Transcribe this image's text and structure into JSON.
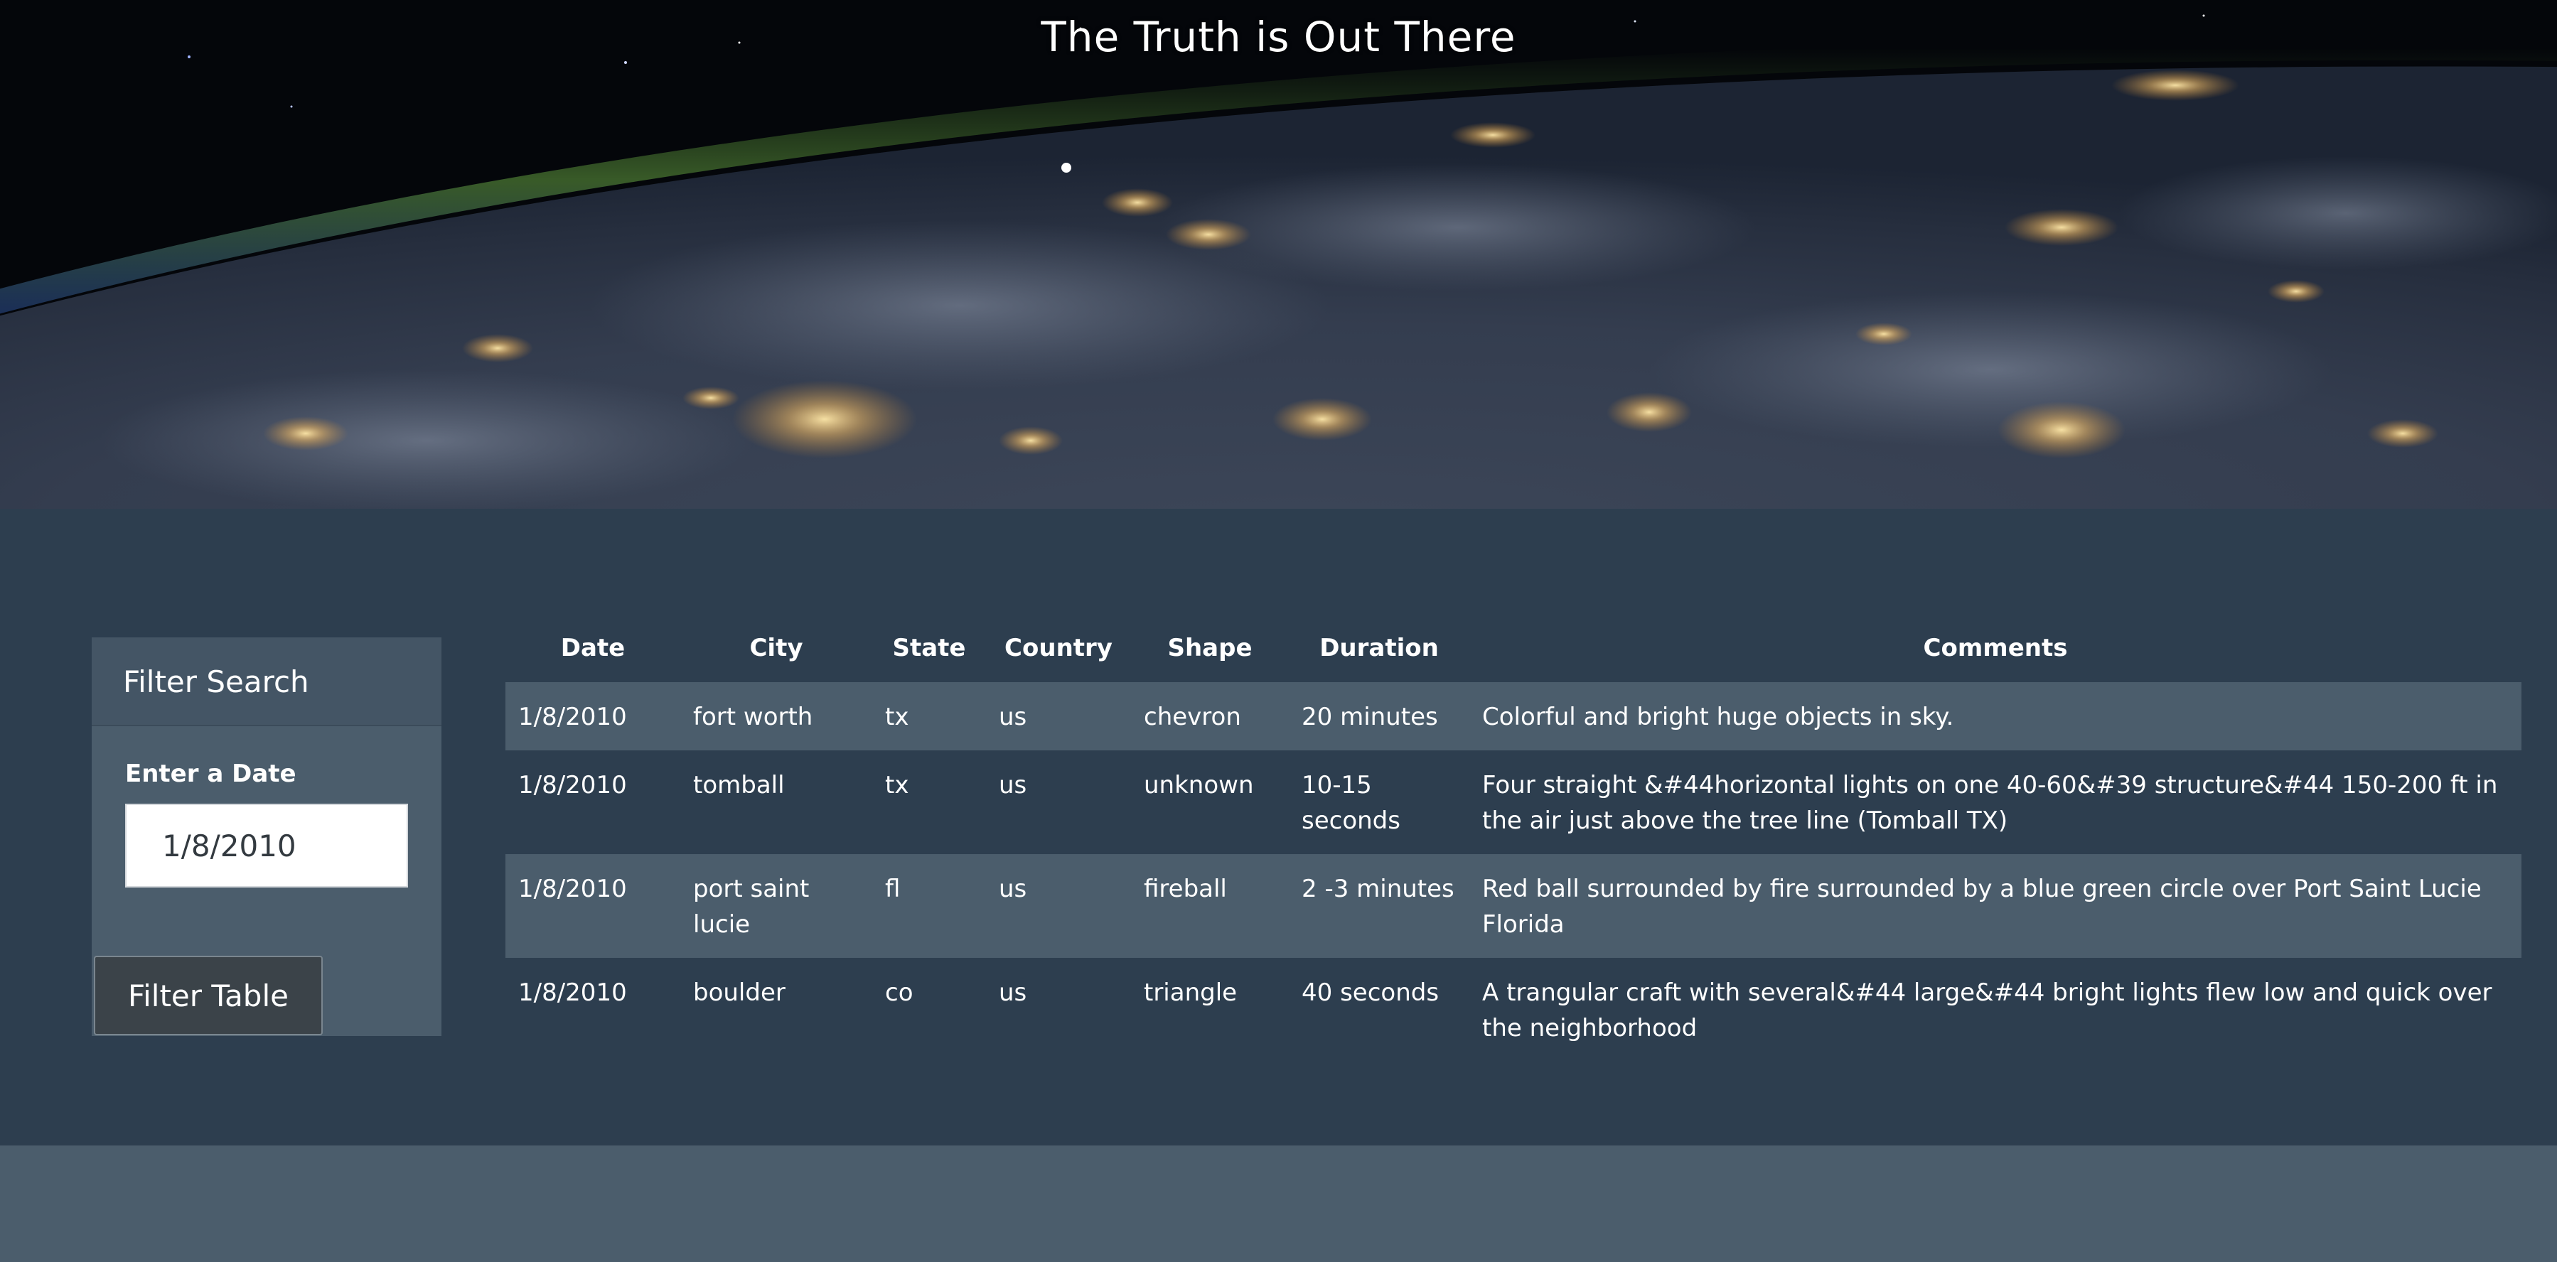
{
  "header": {
    "title": "The Truth is Out There"
  },
  "filter": {
    "heading": "Filter Search",
    "date_label": "Enter a Date",
    "date_value": "1/8/2010",
    "button_label": "Filter Table"
  },
  "table": {
    "headers": {
      "date": "Date",
      "city": "City",
      "state": "State",
      "country": "Country",
      "shape": "Shape",
      "duration": "Duration",
      "comments": "Comments"
    },
    "rows": [
      {
        "date": "1/8/2010",
        "city": "fort worth",
        "state": "tx",
        "country": "us",
        "shape": "chevron",
        "duration": "20 minutes",
        "comments": "Colorful and bright huge objects in sky."
      },
      {
        "date": "1/8/2010",
        "city": "tomball",
        "state": "tx",
        "country": "us",
        "shape": "unknown",
        "duration": "10-15 seconds",
        "comments": "Four straight &#44horizontal lights on one 40-60&#39 structure&#44 150-200 ft in the air just above the tree line (Tomball TX)"
      },
      {
        "date": "1/8/2010",
        "city": "port saint lucie",
        "state": "fl",
        "country": "us",
        "shape": "fireball",
        "duration": "2 -3 minutes",
        "comments": "Red ball surrounded by fire surrounded by a blue green circle over Port Saint Lucie Florida"
      },
      {
        "date": "1/8/2010",
        "city": "boulder",
        "state": "co",
        "country": "us",
        "shape": "triangle",
        "duration": "40 seconds",
        "comments": "A trangular craft with several&#44 large&#44 bright lights flew low and quick over the neighborhood"
      }
    ]
  },
  "colors": {
    "page_band": "#2d3e4f",
    "panel": "#4b5d6c",
    "row_stripe": "#4b5d6c",
    "button": "#3b4349"
  }
}
